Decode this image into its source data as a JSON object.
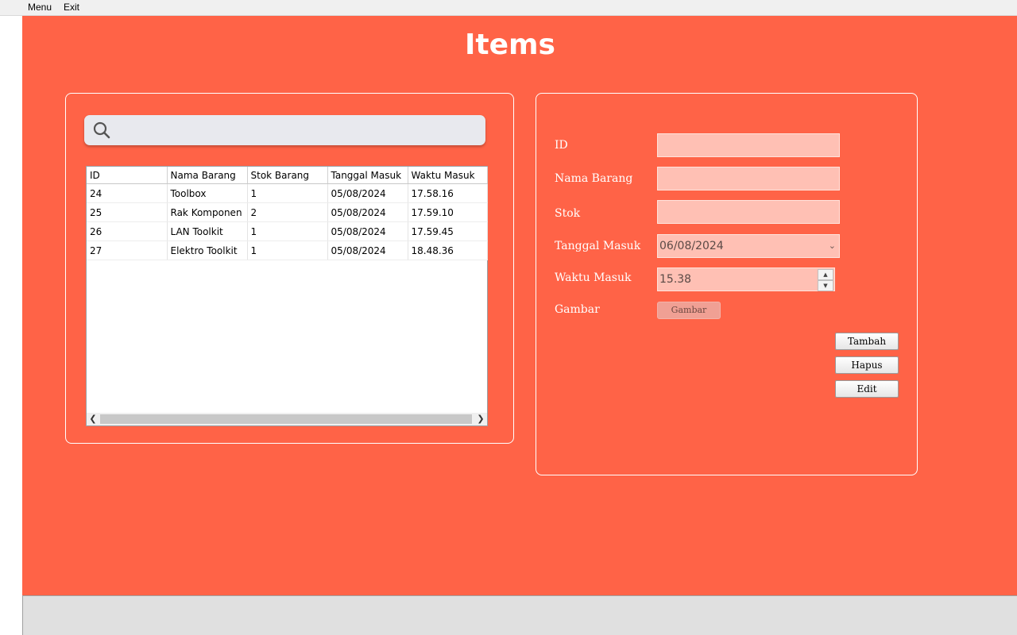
{
  "menubar": {
    "menu": "Menu",
    "exit": "Exit"
  },
  "page_title": "Items",
  "search": {
    "placeholder": "",
    "value": ""
  },
  "table": {
    "columns": [
      "ID",
      "Nama Barang",
      "Stok Barang",
      "Tanggal Masuk",
      "Waktu Masuk"
    ],
    "rows": [
      [
        "24",
        "Toolbox",
        "1",
        "05/08/2024",
        "17.58.16"
      ],
      [
        "25",
        "Rak Komponen",
        "2",
        "05/08/2024",
        "17.59.10"
      ],
      [
        "26",
        "LAN Toolkit",
        "1",
        "05/08/2024",
        "17.59.45"
      ],
      [
        "27",
        "Elektro Toolkit",
        "1",
        "05/08/2024",
        "18.48.36"
      ]
    ]
  },
  "form": {
    "id_label": "ID",
    "id_value": "",
    "nama_label": "Nama Barang",
    "nama_value": "",
    "stok_label": "Stok",
    "stok_value": "",
    "tanggal_label": "Tanggal Masuk",
    "tanggal_value": "06/08/2024",
    "waktu_label": "Waktu Masuk",
    "waktu_value": "15.38",
    "gambar_label": "Gambar",
    "gambar_button": "Gambar"
  },
  "actions": {
    "tambah": "Tambah",
    "hapus": "Hapus",
    "edit": "Edit"
  },
  "colors": {
    "background": "#ff6347",
    "input": "#ffc0b4",
    "panel_border": "#ffffff"
  },
  "icons": {
    "search": "search-icon"
  }
}
